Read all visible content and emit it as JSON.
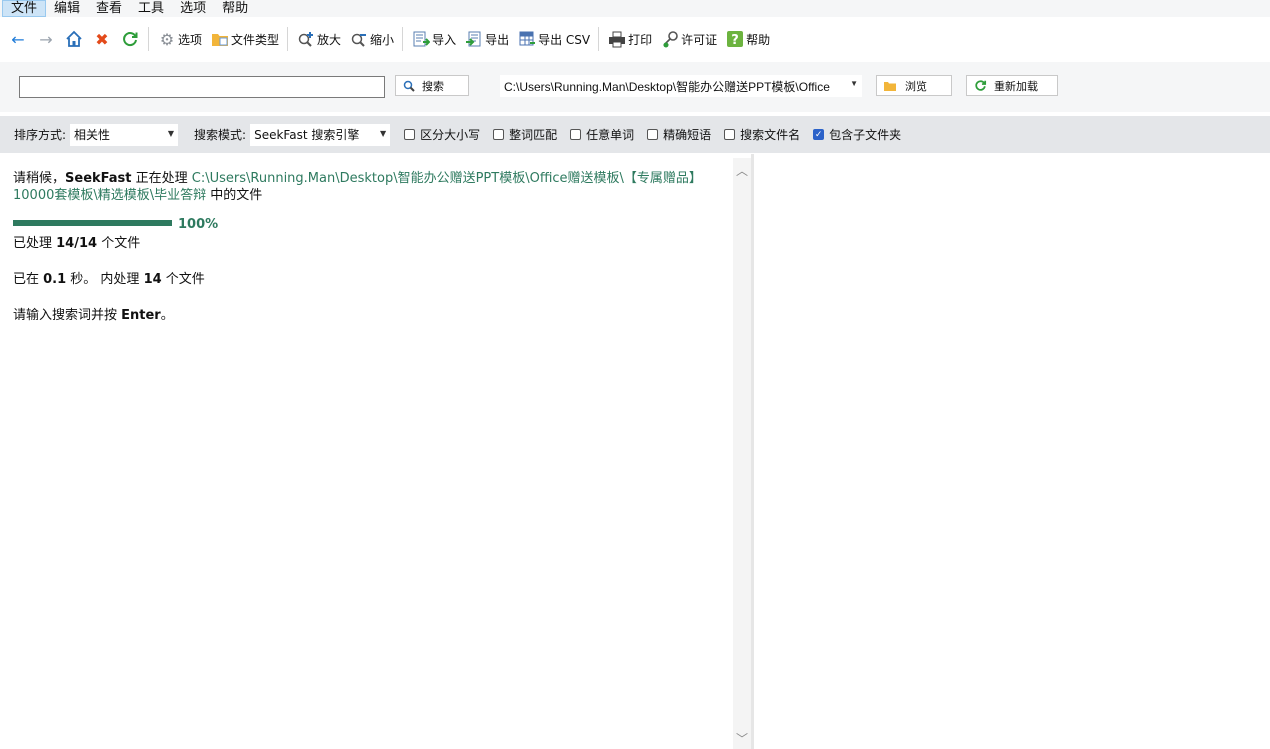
{
  "menu": [
    "文件",
    "编辑",
    "查看",
    "工具",
    "选项",
    "帮助"
  ],
  "toolbar": {
    "options": "选项",
    "file_types": "文件类型",
    "zoom_in": "放大",
    "zoom_out": "缩小",
    "import": "导入",
    "export": "导出",
    "export_csv": "导出 CSV",
    "print": "打印",
    "license": "许可证",
    "help": "帮助"
  },
  "search": {
    "query": "",
    "search_button": "搜索",
    "path": "C:\\Users\\Running.Man\\Desktop\\智能办公赠送PPT模板\\Office",
    "browse_button": "浏览",
    "reload_button": "重新加载"
  },
  "options": {
    "sort_label": "排序方式:",
    "sort_value": "相关性",
    "mode_label": "搜索模式:",
    "mode_value": "SeekFast 搜索引擎",
    "checkboxes": [
      {
        "label": "区分大小写",
        "checked": false
      },
      {
        "label": "整词匹配",
        "checked": false
      },
      {
        "label": "任意单词",
        "checked": false
      },
      {
        "label": "精确短语",
        "checked": false
      },
      {
        "label": "搜索文件名",
        "checked": false
      },
      {
        "label": "包含子文件夹",
        "checked": true
      }
    ]
  },
  "status": {
    "wait_prefix": "请稍候，",
    "app_name": "SeekFast",
    "processing": " 正在处理 ",
    "path": "C:\\Users\\Running.Man\\Desktop\\智能办公赠送PPT模板\\Office赠送模板\\【专属赠品】10000套模板\\精选模板\\毕业答辩",
    "suffix": " 中的文件",
    "progress": 1.0,
    "progress_label": "100%",
    "processed_prefix": "已处理 ",
    "processed_count": "14/14",
    "processed_suffix": " 个文件",
    "time_prefix": "已在 ",
    "time_value": "0.1",
    "time_mid": " 秒。 内处理 ",
    "time_count": "14",
    "time_suffix": " 个文件",
    "hint_prefix": "请输入搜索词并按 ",
    "hint_key": "Enter",
    "hint_suffix": "。"
  }
}
